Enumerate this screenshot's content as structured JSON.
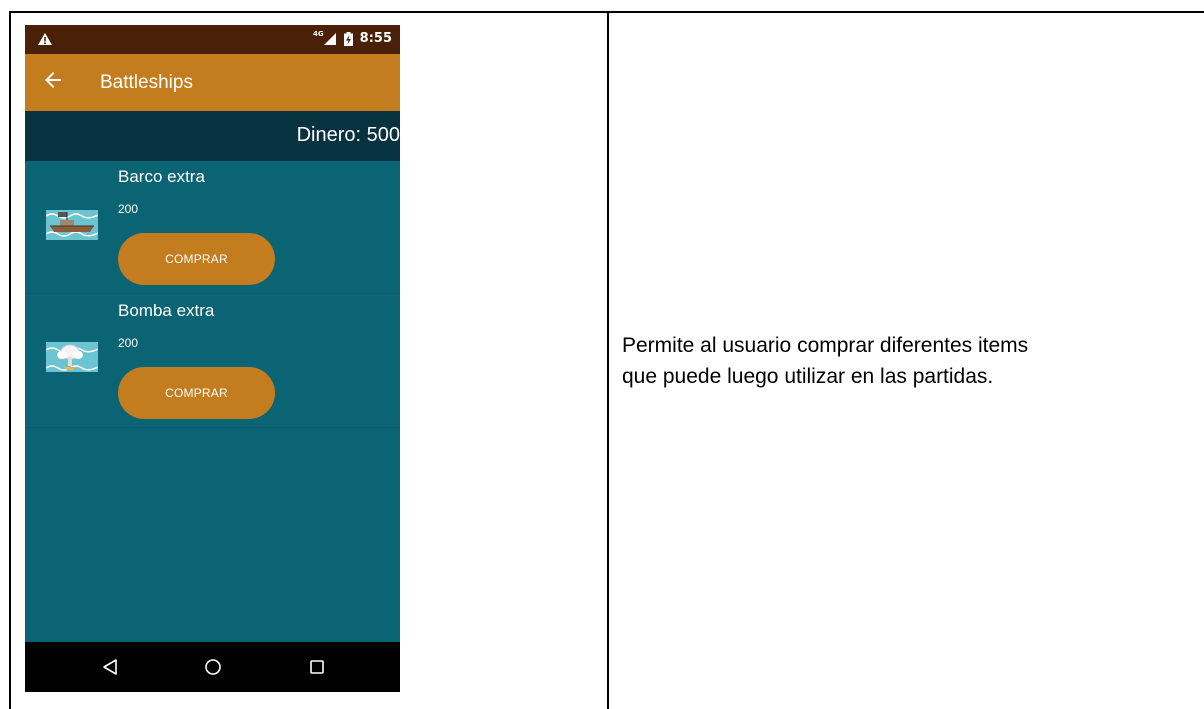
{
  "status_bar": {
    "network": "4G",
    "time": "8:55"
  },
  "app_bar": {
    "title": "Battleships"
  },
  "shop": {
    "money_label": "Dinero: 500",
    "items": [
      {
        "name": "Barco extra",
        "price": "200",
        "button_label": "COMPRAR",
        "thumbnail": "ship-thumbnail"
      },
      {
        "name": "Bomba extra",
        "price": "200",
        "button_label": "COMPRAR",
        "thumbnail": "bomb-thumbnail"
      }
    ]
  },
  "description": {
    "line1": "Permite al usuario comprar diferentes items",
    "line2": "que puede luego utilizar en las partidas."
  },
  "colors": {
    "status_bar": "#4a2108",
    "app_bar": "#c37d1e",
    "money_bar": "#07323f",
    "list_background": "#0b6474",
    "button": "#c37d1e",
    "nav_bar": "#000000"
  }
}
